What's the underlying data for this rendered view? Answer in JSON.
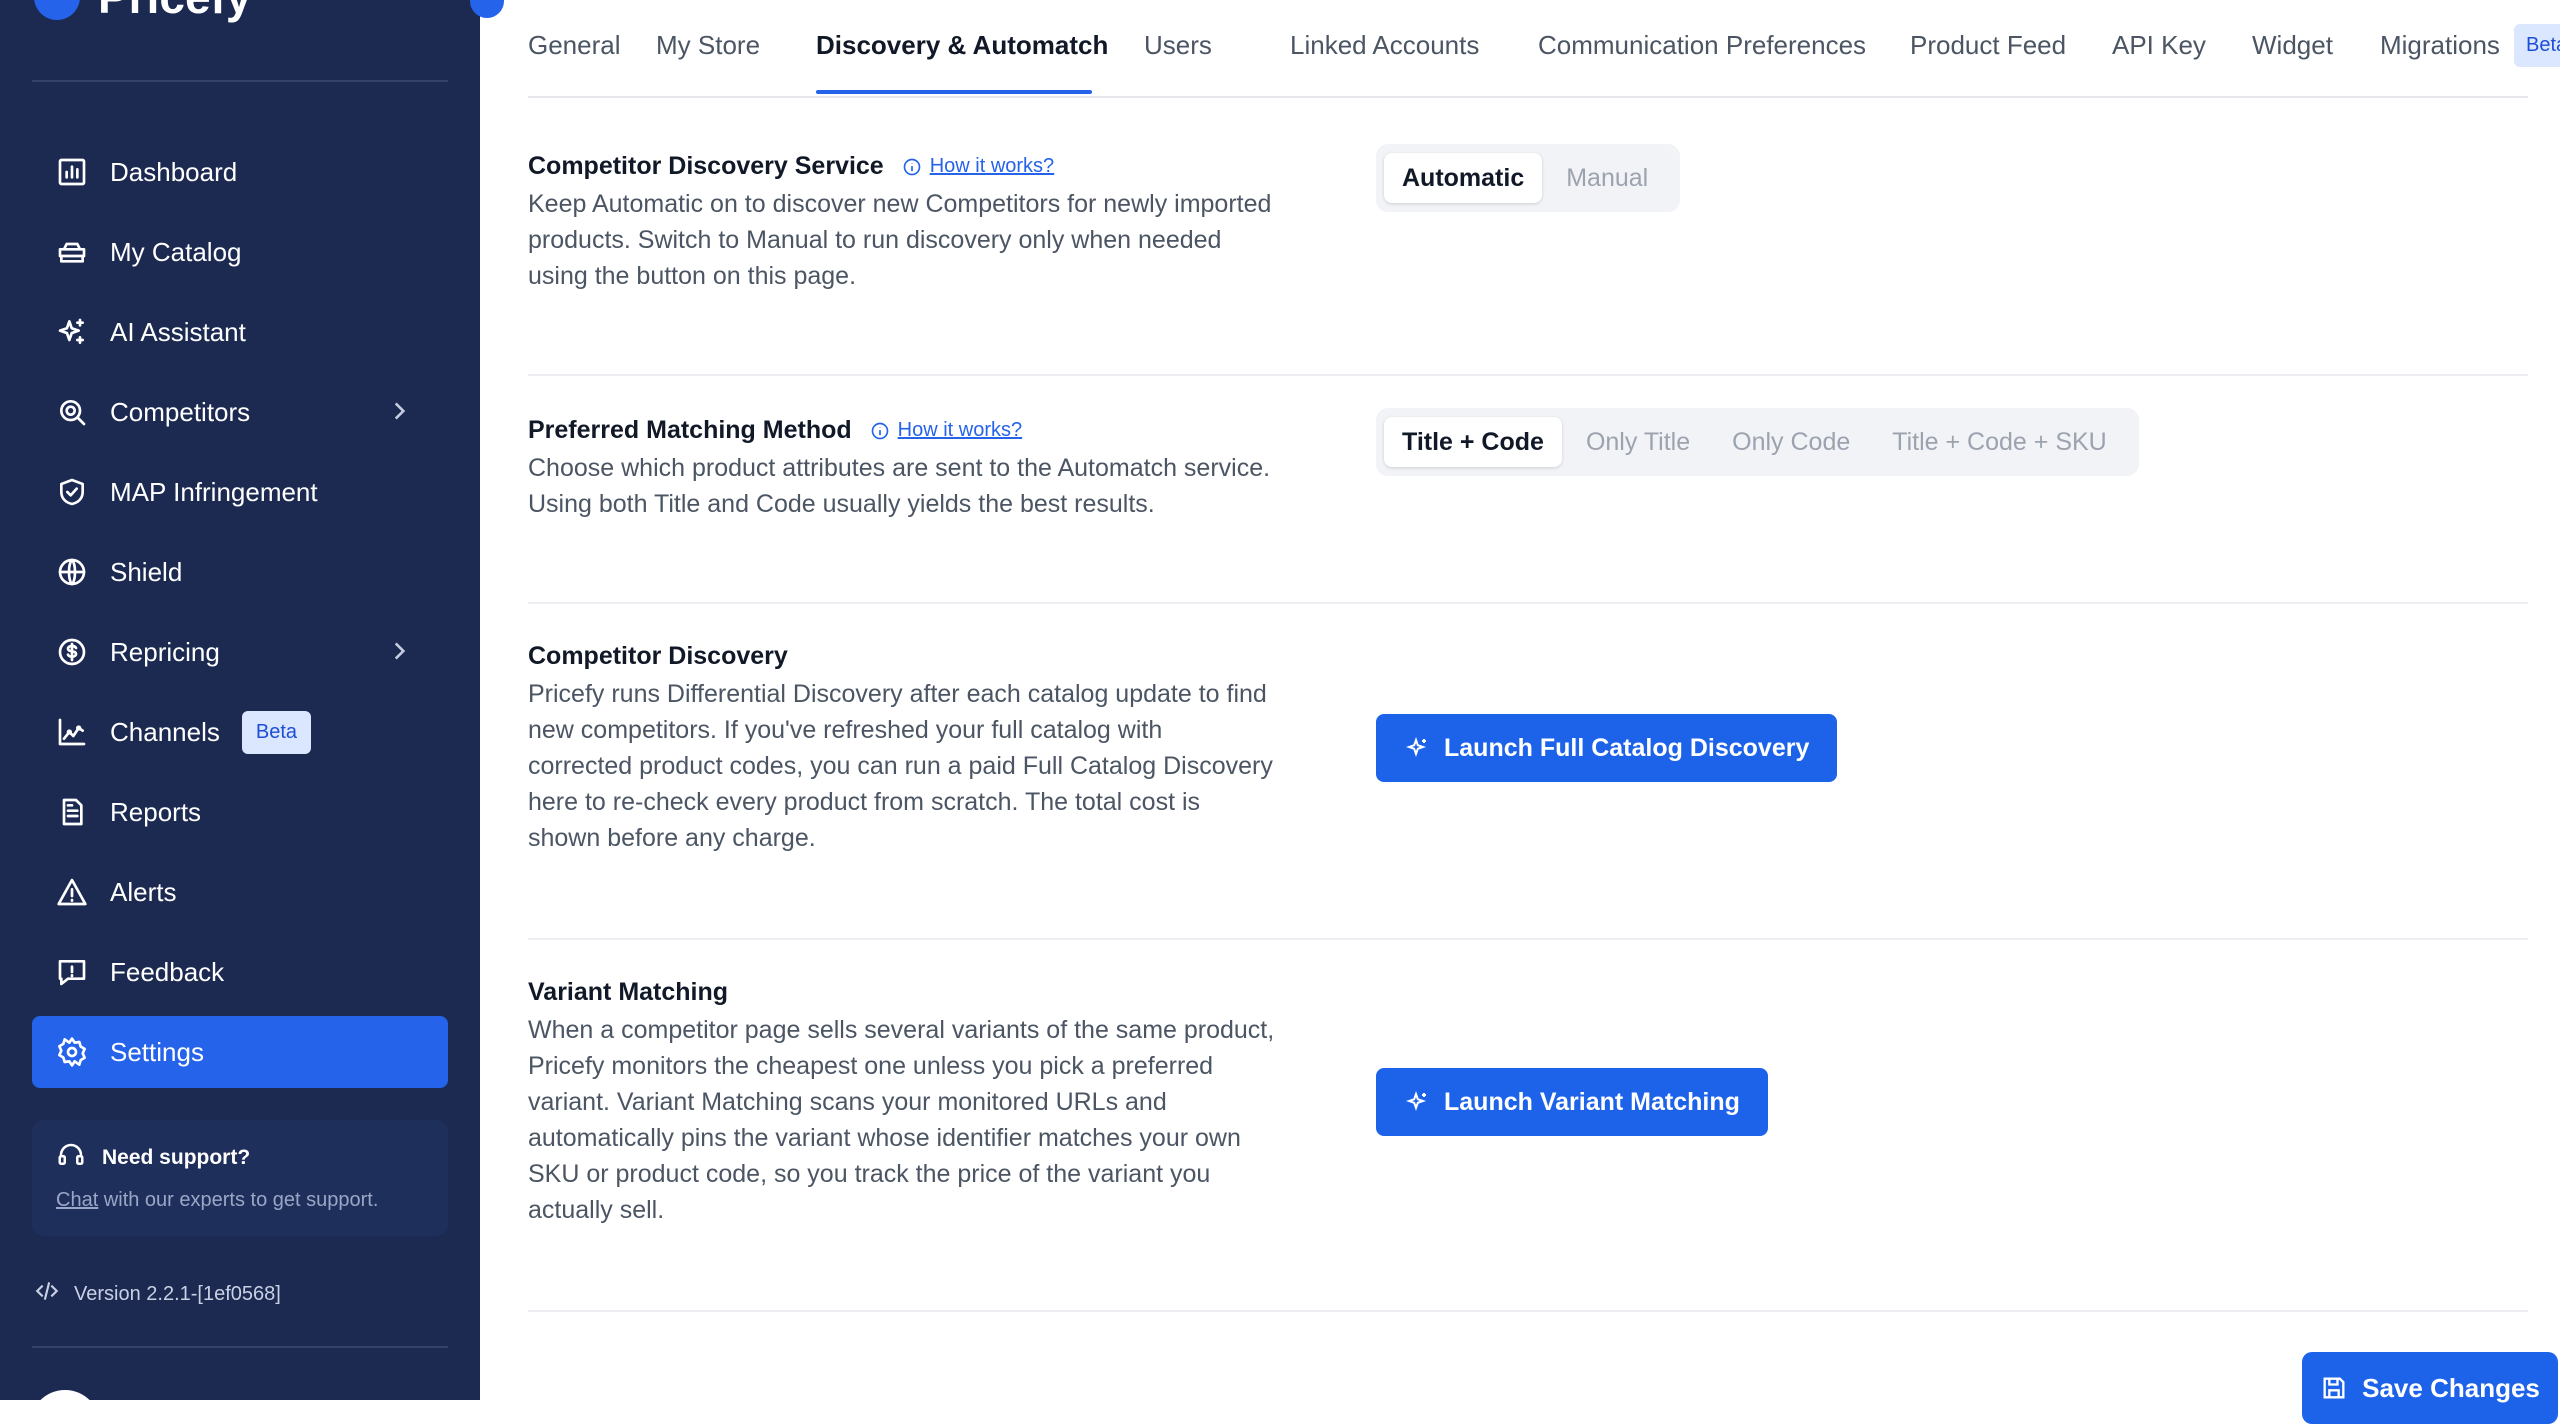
{
  "brand": {
    "name": "Pricefy"
  },
  "sidebar": {
    "items": [
      {
        "label": "Dashboard",
        "icon": "chart-bar-icon"
      },
      {
        "label": "My Catalog",
        "icon": "catalog-icon"
      },
      {
        "label": "AI Assistant",
        "icon": "sparkles-icon"
      },
      {
        "label": "Competitors",
        "icon": "search-icon",
        "has_submenu": true
      },
      {
        "label": "MAP Infringement",
        "icon": "shield-check-icon"
      },
      {
        "label": "Shield",
        "icon": "globe-icon"
      },
      {
        "label": "Repricing",
        "icon": "dollar-circle-icon",
        "has_submenu": true
      },
      {
        "label": "Channels",
        "icon": "channels-icon",
        "badge": "Beta"
      },
      {
        "label": "Reports",
        "icon": "document-icon"
      },
      {
        "label": "Alerts",
        "icon": "warning-icon"
      },
      {
        "label": "Feedback",
        "icon": "feedback-icon"
      },
      {
        "label": "Settings",
        "icon": "gear-icon",
        "active": true
      }
    ],
    "support": {
      "title": "Need support?",
      "link": "Chat",
      "text": " with our experts to get support."
    },
    "version": "Version 2.2.1-[1ef0568]"
  },
  "tabs": [
    {
      "label": "General"
    },
    {
      "label": "My Store"
    },
    {
      "label": "Discovery & Automatch",
      "active": true
    },
    {
      "label": "Users"
    },
    {
      "label": "Linked Accounts"
    },
    {
      "label": "Communication Preferences"
    },
    {
      "label": "Product Feed"
    },
    {
      "label": "API Key"
    },
    {
      "label": "Widget"
    },
    {
      "label": "Migrations",
      "badge": "Beta"
    }
  ],
  "sections": {
    "discovery_service": {
      "title": "Competitor Discovery Service",
      "howto": "How it works?",
      "lines": [
        "Keep Automatic on to discover new Competitors for newly imported",
        "products. Switch to Manual to run discovery only when needed",
        "using the button on this page."
      ],
      "options": [
        "Automatic",
        "Manual"
      ],
      "selected": "Automatic"
    },
    "matching_method": {
      "title": "Preferred Matching Method",
      "howto": "How it works?",
      "lines": [
        "Choose which product attributes are sent to the Automatch service.",
        "Using both Title and Code usually yields the best results."
      ],
      "options": [
        "Title + Code",
        "Only Title",
        "Only Code",
        "Title + Code + SKU"
      ],
      "selected": "Title + Code"
    },
    "competitor_discovery": {
      "title": "Competitor Discovery",
      "lines": [
        "Pricefy runs Differential Discovery after each catalog update to find",
        "new competitors. If you've refreshed your full catalog with",
        "corrected product codes, you can run a paid Full Catalog Discovery",
        "here to re-check every product from scratch. The total cost is",
        "shown before any charge."
      ],
      "button": "Launch Full Catalog Discovery"
    },
    "variant_matching": {
      "title": "Variant Matching",
      "lines": [
        "When a competitor page sells several variants of the same product,",
        "Pricefy monitors the cheapest one unless you pick a preferred",
        "variant. Variant Matching scans your monitored URLs and",
        "automatically pins the variant whose identifier matches your own",
        "SKU or product code, so you track the price of the variant you",
        "actually sell."
      ],
      "button": "Launch Variant Matching"
    }
  },
  "save_button": "Save Changes",
  "colors": {
    "sidebar_bg": "#1c2a52",
    "accent": "#2563eb",
    "beta_bg": "#dbe7ff"
  }
}
